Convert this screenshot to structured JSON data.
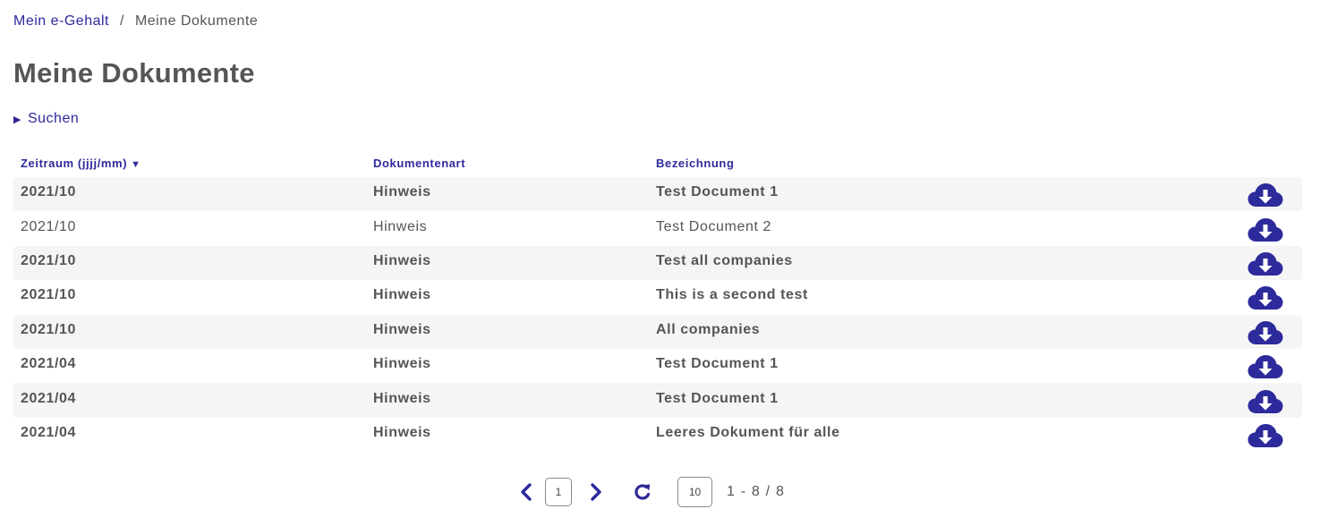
{
  "breadcrumb": {
    "home": "Mein e-Gehalt",
    "separator": "/",
    "current": "Meine Dokumente"
  },
  "page_title": "Meine Dokumente",
  "search_toggle": {
    "label": "Suchen",
    "expanded": false
  },
  "table": {
    "headers": {
      "period": "Zeitraum (jjjj/mm)",
      "type": "Dokumentenart",
      "name": "Bezeichnung"
    },
    "sort": {
      "column": "period",
      "direction": "descending",
      "icon": "sort-down-triangle"
    },
    "action_icon": "cloud-download-icon",
    "rows": [
      {
        "period": "2021/10",
        "type": "Hinweis",
        "name": "Test Document 1",
        "unread": true
      },
      {
        "period": "2021/10",
        "type": "Hinweis",
        "name": "Test Document 2",
        "unread": false
      },
      {
        "period": "2021/10",
        "type": "Hinweis",
        "name": "Test all companies",
        "unread": true
      },
      {
        "period": "2021/10",
        "type": "Hinweis",
        "name": "This is a second test",
        "unread": true
      },
      {
        "period": "2021/10",
        "type": "Hinweis",
        "name": "All companies",
        "unread": true
      },
      {
        "period": "2021/04",
        "type": "Hinweis",
        "name": "Test Document 1",
        "unread": true
      },
      {
        "period": "2021/04",
        "type": "Hinweis",
        "name": "Test Document 1",
        "unread": true
      },
      {
        "period": "2021/04",
        "type": "Hinweis",
        "name": "Leeres Dokument für alle",
        "unread": true
      }
    ]
  },
  "pagination": {
    "current_page": "1",
    "page_size": "10",
    "range": "1 - 8 / 8",
    "icons": {
      "prev": "chevron-left-icon",
      "next": "chevron-right-icon",
      "refresh": "refresh-icon"
    }
  },
  "colors": {
    "accent": "#2d2a9c",
    "text": "#555555",
    "stripe": "#f5f5f5"
  }
}
